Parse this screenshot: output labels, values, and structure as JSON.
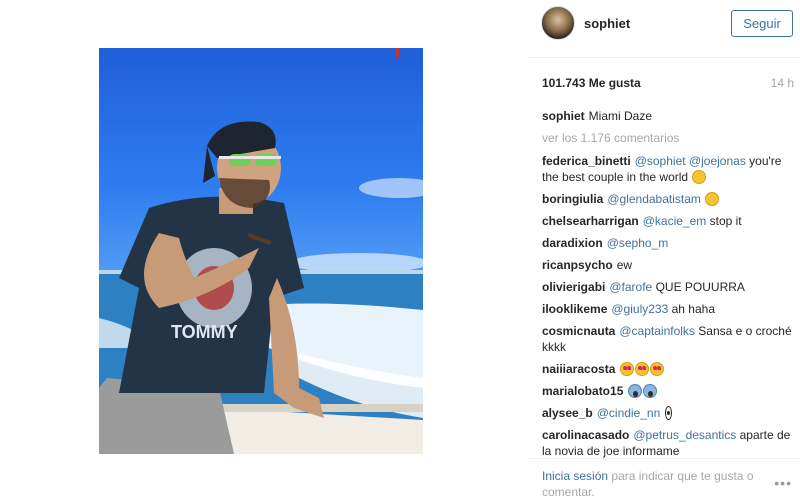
{
  "post": {
    "username": "sophiet",
    "follow_label": "Seguir",
    "likes": "101.743 Me gusta",
    "time_ago": "14 h",
    "caption_user": "sophiet",
    "caption_text": "Miami Daze",
    "view_all_comments": "ver los 1.176 comentarios"
  },
  "comments": [
    {
      "user": "federica_binetti",
      "mentions": [
        "@sophiet",
        "@joejonas"
      ],
      "text": "you're the best couple in the world",
      "emoji": [
        "grin"
      ]
    },
    {
      "user": "boringiulia",
      "mentions": [
        "@glendabatistam"
      ],
      "text": "",
      "emoji": [
        "confused"
      ]
    },
    {
      "user": "chelsearharrigan",
      "mentions": [
        "@kacie_em"
      ],
      "text": "stop it",
      "emoji": []
    },
    {
      "user": "daradixion",
      "mentions": [
        "@sepho_m"
      ],
      "text": "",
      "emoji": []
    },
    {
      "user": "ricanpsycho",
      "mentions": [],
      "text": "ew",
      "emoji": []
    },
    {
      "user": "olivierigabi",
      "mentions": [
        "@farofe"
      ],
      "text": "QUE POUURRA",
      "emoji": []
    },
    {
      "user": "ilooklikeme",
      "mentions": [
        "@giuly233"
      ],
      "text": "ah haha",
      "emoji": []
    },
    {
      "user": "cosmicnauta",
      "mentions": [
        "@captainfolks"
      ],
      "text": "Sansa e o croché kkkk",
      "emoji": []
    },
    {
      "user": "naiiiaracosta",
      "mentions": [],
      "text": "",
      "emoji": [
        "heart-eyes",
        "heart-eyes",
        "heart-eyes"
      ]
    },
    {
      "user": "marialobato15",
      "mentions": [],
      "text": "",
      "emoji": [
        "scream",
        "scream"
      ]
    },
    {
      "user": "alysee_b",
      "mentions": [
        "@cindie_nn"
      ],
      "text": "",
      "emoji": [
        "eyes"
      ]
    },
    {
      "user": "carolinacasado",
      "mentions": [
        "@petrus_desantics"
      ],
      "text": "aparte de la novia de joe informame",
      "emoji": []
    }
  ],
  "footer": {
    "login_link": "Inicia sesión",
    "login_rest": "para indicar que te gusta o comentar.",
    "more_label": "•••"
  },
  "colors": {
    "link_blue": "#3f729b",
    "muted_gray": "#a5a7aa",
    "text_dark": "#262626"
  }
}
